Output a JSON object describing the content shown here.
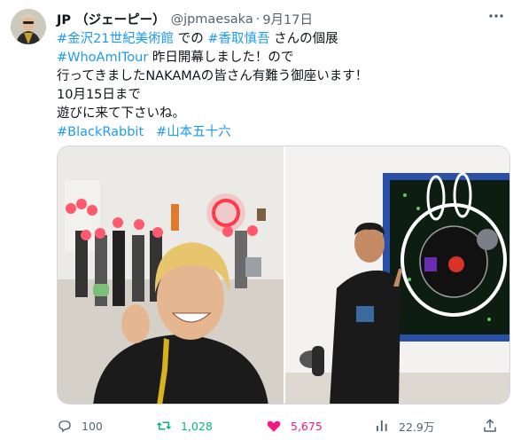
{
  "tweet": {
    "display_name": "JP （ジェーピー）",
    "handle": "@jpmaesaka",
    "separator": "·",
    "date": "9月17日",
    "line1": {
      "tag1": "#金沢21世紀美術館",
      "mid": " での ",
      "tag2": "#香取慎吾",
      "end": " さんの個展"
    },
    "line2": {
      "tag": "#WhoAmITour",
      "end": " 昨日開幕しました！ので"
    },
    "line3": "行ってきましたNAKAMAの皆さん有難う御座います！",
    "line4": "10月15日まで",
    "line5": "遊びに来て下さいね。",
    "line6": {
      "tag1": "#BlackRabbit",
      "tag2": "#山本五十六"
    }
  },
  "media": {
    "photo1_icon": "museum-group-selfie-photo",
    "photo2_icon": "man-with-painting-photo"
  },
  "actions": {
    "replies": "100",
    "retweets": "1,028",
    "likes": "5,675",
    "views": "22.9万"
  },
  "colors": {
    "link": "#1d9bf0",
    "retweet": "#00ba7c",
    "like": "#f91880",
    "muted": "#536471"
  }
}
